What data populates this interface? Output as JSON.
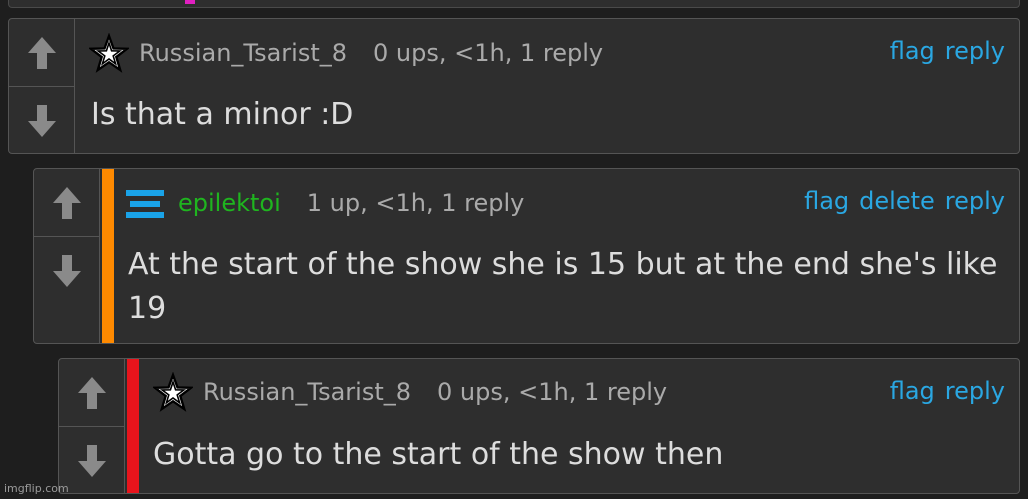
{
  "colors": {
    "accent": "#2aa7e2",
    "stripe_orange": "#ff8a00",
    "stripe_red": "#e8141c",
    "green_user": "#1fb51f"
  },
  "comments": [
    {
      "username": "Russian_Tsarist_8",
      "meta": "0 ups, <1h, 1 reply",
      "actions": [
        "flag",
        "reply"
      ],
      "text": "Is that a minor :D",
      "avatar_icon": "star-icon"
    },
    {
      "username": "epilektoi",
      "meta": "1 up, <1h, 1 reply",
      "actions": [
        "flag",
        "delete",
        "reply"
      ],
      "text": "At the start of the show she is 15 but at the end she's like 19",
      "avatar_icon": "hamburger-icon"
    },
    {
      "username": "Russian_Tsarist_8",
      "meta": "0 ups, <1h, 1 reply",
      "actions": [
        "flag",
        "reply"
      ],
      "text": "Gotta go to the start of the show then",
      "avatar_icon": "star-icon"
    }
  ],
  "watermark": "imgflip.com"
}
